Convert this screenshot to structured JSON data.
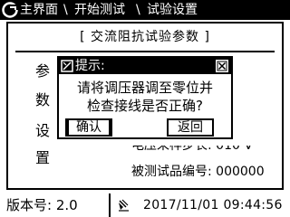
{
  "titlebar": {
    "crumbs": [
      "主界面",
      "开始测试",
      "试验设置"
    ],
    "separator": "\\"
  },
  "panel": {
    "title": "[ 交流阻抗试验参数 ]",
    "side_labels": [
      "参",
      "数",
      "设",
      "置"
    ],
    "partial_line": "电压采样步长: 010 V",
    "sample_number_line": "被测试品编号: 000000"
  },
  "dialog": {
    "title": "提示:",
    "message_line1": "请将调压器调至零位并",
    "message_line2": "检查接线是否正确?",
    "confirm_label": "确认",
    "back_label": "返回"
  },
  "status": {
    "version": "版本号: 2.0",
    "datetime": "2017/11/01 09:44:56"
  }
}
